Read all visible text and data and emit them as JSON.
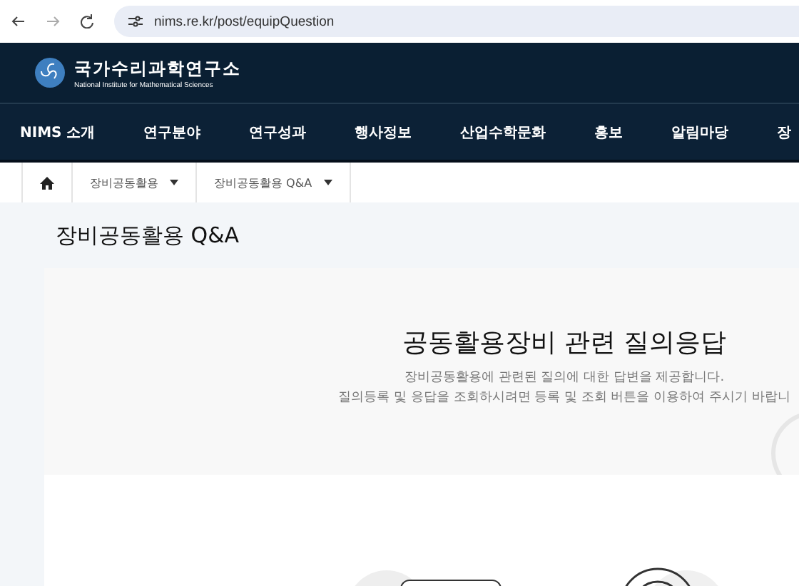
{
  "browser": {
    "url": "nims.re.kr/post/equipQuestion"
  },
  "header": {
    "logo_name": "국가수리과학연구소",
    "logo_subtitle": "National Institute for Mathematical Sciences"
  },
  "nav": [
    "NIMS 소개",
    "연구분야",
    "연구성과",
    "행사정보",
    "산업수학문화",
    "홍보",
    "알림마당",
    "장"
  ],
  "breadcrumb": [
    "장비공동활용",
    "장비공동활용 Q&A"
  ],
  "page_title": "장비공동활용 Q&A",
  "intro": {
    "heading": "공동활용장비 관련 질의응답",
    "lines": [
      "장비공동활용에 관련된 질의에 대한 답변을 제공합니다.",
      "질의등록 및 응답을 조회하시려면 등록 및 조회 버튼을 이용하여 주시기 바랍니"
    ]
  }
}
